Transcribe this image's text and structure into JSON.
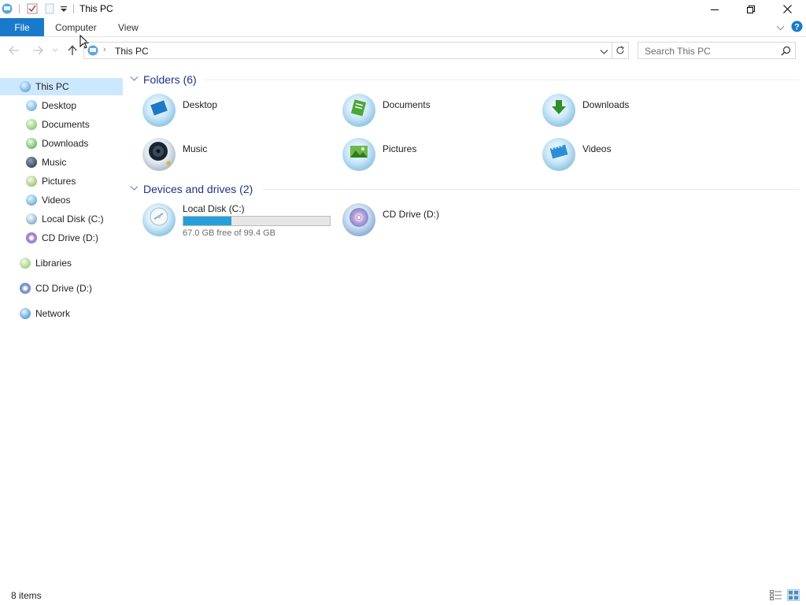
{
  "window": {
    "title": "This PC"
  },
  "ribbon": {
    "file": "File",
    "tabs": [
      "Computer",
      "View"
    ]
  },
  "address": {
    "location": "This PC",
    "search_placeholder": "Search This PC"
  },
  "sidebar": {
    "items": [
      {
        "label": "This PC",
        "icon": "this-pc-icon",
        "selected": true
      },
      {
        "label": "Desktop",
        "icon": "desktop-icon"
      },
      {
        "label": "Documents",
        "icon": "documents-icon"
      },
      {
        "label": "Downloads",
        "icon": "downloads-icon"
      },
      {
        "label": "Music",
        "icon": "music-icon"
      },
      {
        "label": "Pictures",
        "icon": "pictures-icon"
      },
      {
        "label": "Videos",
        "icon": "videos-icon"
      },
      {
        "label": "Local Disk (C:)",
        "icon": "local-disk-icon"
      },
      {
        "label": "CD Drive (D:)",
        "icon": "cd-drive-icon"
      },
      {
        "label": "Libraries",
        "icon": "libraries-icon"
      },
      {
        "label": "CD Drive (D:)",
        "icon": "cd-drive-icon"
      },
      {
        "label": "Network",
        "icon": "network-icon"
      }
    ]
  },
  "content": {
    "folders_group": "Folders (6)",
    "folders": [
      {
        "label": "Desktop",
        "icon": "desktop-icon"
      },
      {
        "label": "Documents",
        "icon": "documents-icon"
      },
      {
        "label": "Downloads",
        "icon": "downloads-icon"
      },
      {
        "label": "Music",
        "icon": "music-icon"
      },
      {
        "label": "Pictures",
        "icon": "pictures-icon"
      },
      {
        "label": "Videos",
        "icon": "videos-icon"
      }
    ],
    "devices_group": "Devices and drives (2)",
    "drives": [
      {
        "label": "Local Disk (C:)",
        "icon": "local-disk-icon",
        "free_text": "67.0 GB free of 99.4 GB",
        "used_fraction": 0.326
      },
      {
        "label": "CD Drive (D:)",
        "icon": "cd-drive-icon"
      }
    ]
  },
  "status": {
    "count": "8 items"
  },
  "colors": {
    "accent": "#1979ca",
    "selected_bg": "#cce8ff",
    "group_title": "#1e3287",
    "drive_fill": "#26a0da"
  }
}
